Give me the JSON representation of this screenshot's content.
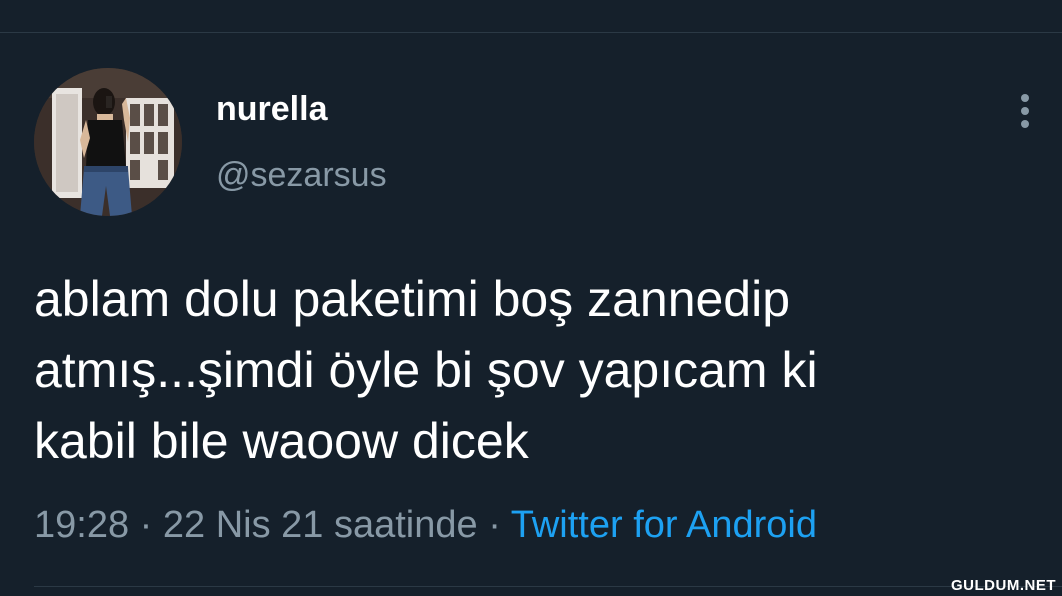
{
  "colors": {
    "background": "#15202b",
    "text_primary": "#ffffff",
    "text_secondary": "#8899a6",
    "accent": "#1da1f2",
    "divider": "#2b3945"
  },
  "tweet": {
    "author": {
      "display_name": "nurella",
      "handle": "@sezarsus",
      "avatar_icon": "profile-photo"
    },
    "more_icon": "vertical-ellipsis-icon",
    "text_lines": [
      "ablam dolu paketimi boş zannedip",
      "atmış...şimdi öyle bi şov yapıcam ki",
      "kabil bile waoow dicek"
    ],
    "meta": {
      "time": "19:28",
      "date": "22 Nis 21 saatinde",
      "separator": "·",
      "source": "Twitter for Android"
    }
  },
  "watermark": "GULDUM.NET"
}
